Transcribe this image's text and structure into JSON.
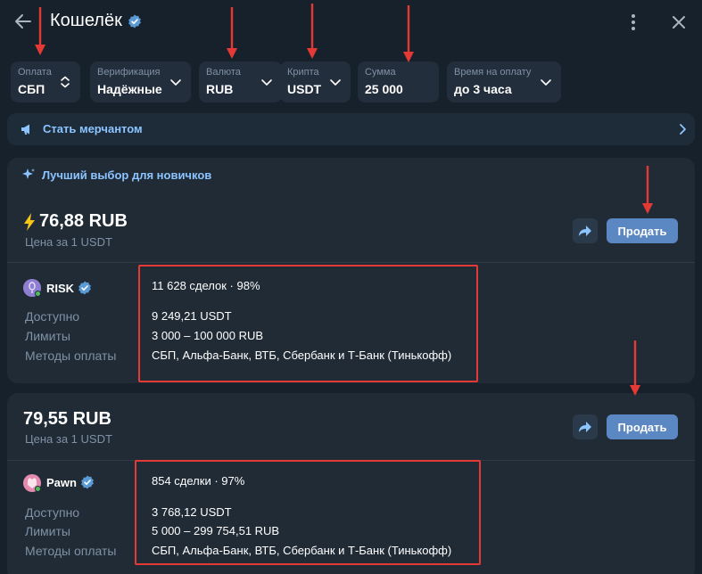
{
  "header": {
    "title": "Кошелёк"
  },
  "filters": [
    {
      "label": "Оплата",
      "value": "СБП",
      "chevron": "updown"
    },
    {
      "label": "Верификация",
      "value": "Надёжные",
      "chevron": "down"
    },
    {
      "label": "Валюта",
      "value": "RUB",
      "chevron": "down"
    },
    {
      "label": "Крипта",
      "value": "USDT",
      "chevron": "down"
    },
    {
      "label": "Сумма",
      "value": "25 000",
      "chevron": "none"
    },
    {
      "label": "Время на оплату",
      "value": "до 3 часа",
      "chevron": "down"
    }
  ],
  "merchant_banner": {
    "text": "Стать мерчантом"
  },
  "offers": [
    {
      "badge": "Лучший выбор для новичков",
      "price": "76,88 RUB",
      "price_note": "Цена за 1 USDT",
      "action": "Продать",
      "seller": "RISK",
      "deals": "11 628 сделок · 98%",
      "available_label": "Доступно",
      "available": "9 249,21 USDT",
      "limits_label": "Лимиты",
      "limits": "3 000 – 100 000 RUB",
      "methods_label": "Методы оплаты",
      "methods": "СБП, Альфа-Банк, ВТБ, Сбербанк и Т-Банк (Тинькофф)"
    },
    {
      "price": "79,55 RUB",
      "price_note": "Цена за 1 USDT",
      "action": "Продать",
      "seller": "Pawn",
      "deals": "854 сделки · 97%",
      "available_label": "Доступно",
      "available": "3 768,12 USDT",
      "limits_label": "Лимиты",
      "limits": "5 000 – 299 754,51 RUB",
      "methods_label": "Методы оплаты",
      "methods": "СБП, Альфа-Банк, ВТБ, Сбербанк и Т-Банк (Тинькофф)"
    }
  ],
  "colors": {
    "background": "#17212b",
    "card": "#202b36",
    "accent": "#8cc4ff",
    "sell_button": "#5b87c2",
    "annotation": "#e53935"
  }
}
